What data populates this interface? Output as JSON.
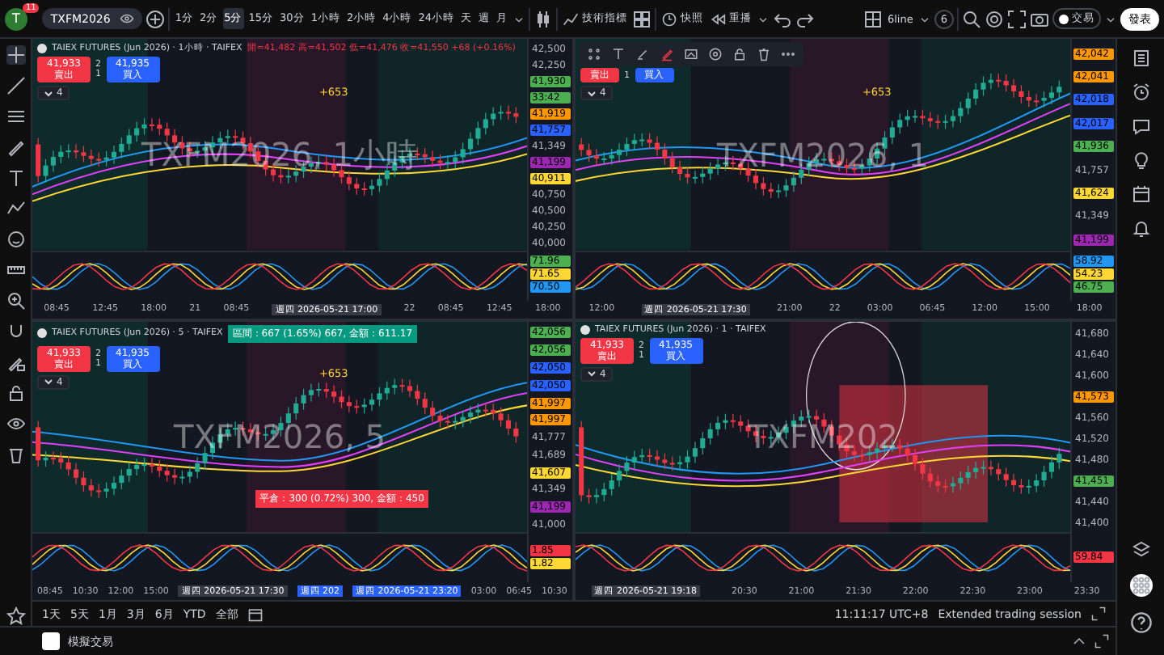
{
  "top_bar": {
    "avatar": "T",
    "badge": "11",
    "symbol": "TXFM2026",
    "intervals": [
      {
        "label": "1分",
        "selected": false
      },
      {
        "label": "2分",
        "selected": false
      },
      {
        "label": "5分",
        "selected": true
      },
      {
        "label": "15分",
        "selected": false
      },
      {
        "label": "30分",
        "selected": false
      },
      {
        "label": "1小時",
        "selected": false
      },
      {
        "label": "2小時",
        "selected": false
      },
      {
        "label": "4小時",
        "selected": false
      },
      {
        "label": "24小時",
        "selected": false
      },
      {
        "label": "天",
        "selected": false
      },
      {
        "label": "週",
        "selected": false
      },
      {
        "label": "月",
        "selected": false
      }
    ],
    "indicators": "技術指標",
    "snapshot": "快照",
    "replay": "重播",
    "layout_name": "6line",
    "layout_count": "6",
    "trade": "交易",
    "publish": "發表"
  },
  "panes": [
    {
      "title": "TAIEX FUTURES (Jun 2026) · 1小時 · TAIFEX",
      "ohlc": "開=41,482 高=41,502 低=41,476 收=41,550 +68 (+0.16%)",
      "sell_price": "41,933",
      "sell_label": "賣出",
      "spread": "2",
      "qty": "1",
      "buy_price": "41,935",
      "buy_label": "買入",
      "collapse": "4",
      "marker": "+653",
      "watermark": "TXFM2026, 1小時",
      "drawing_toolbar": false,
      "price_axis": [
        {
          "text": "42,500",
          "kind": "tick"
        },
        {
          "text": "42,250",
          "kind": "tick"
        },
        {
          "text": "41,930",
          "kind": "tag",
          "color": "#4caf50"
        },
        {
          "text": "33:42",
          "kind": "tag",
          "color": "#4caf50"
        },
        {
          "text": "41,919",
          "kind": "tag",
          "color": "#ff9800"
        },
        {
          "text": "41,757",
          "kind": "tag",
          "color": "#2962ff"
        },
        {
          "text": "41,349",
          "kind": "tick"
        },
        {
          "text": "41,199",
          "kind": "tag",
          "color": "#9c27b0"
        },
        {
          "text": "40,911",
          "kind": "tag",
          "color": "#fdd835"
        },
        {
          "text": "40,750",
          "kind": "tick"
        },
        {
          "text": "40,500",
          "kind": "tick"
        },
        {
          "text": "40,250",
          "kind": "tick"
        },
        {
          "text": "40,000",
          "kind": "tick"
        }
      ],
      "indicator_axis": [
        {
          "text": "71.96",
          "color": "#4caf50"
        },
        {
          "text": "71.65",
          "color": "#fdd835"
        },
        {
          "text": "70.50",
          "color": "#2196f3"
        }
      ],
      "time_axis": [
        {
          "text": "08:45",
          "kind": "tick"
        },
        {
          "text": "12:45",
          "kind": "tick"
        },
        {
          "text": "18:00",
          "kind": "tick"
        },
        {
          "text": "21",
          "kind": "tick"
        },
        {
          "text": "08:45",
          "kind": "tick"
        },
        {
          "text": "週四 2026-05-21  17:00",
          "kind": "tag"
        },
        {
          "text": "22",
          "kind": "tick"
        },
        {
          "text": "08:45",
          "kind": "tick"
        },
        {
          "text": "12:45",
          "kind": "tick"
        },
        {
          "text": "18:00",
          "kind": "tick"
        }
      ]
    },
    {
      "sell_label": "賣出",
      "qty": "1",
      "buy_label": "買入",
      "collapse": "4",
      "marker": "+653",
      "watermark": "TXFM2026, 1",
      "drawing_toolbar": true,
      "price_axis": [
        {
          "text": "42,042",
          "kind": "tag",
          "color": "#ff9800"
        },
        {
          "text": "42,041",
          "kind": "tag",
          "color": "#ff9800"
        },
        {
          "text": "42,018",
          "kind": "tag",
          "color": "#2962ff"
        },
        {
          "text": "42,017",
          "kind": "tag",
          "color": "#2962ff"
        },
        {
          "text": "41,936",
          "kind": "tag",
          "color": "#4caf50"
        },
        {
          "text": "41,757",
          "kind": "tick"
        },
        {
          "text": "41,624",
          "kind": "tag",
          "color": "#fdd835"
        },
        {
          "text": "41,349",
          "kind": "tick"
        },
        {
          "text": "41,199",
          "kind": "tag",
          "color": "#9c27b0"
        }
      ],
      "indicator_axis": [
        {
          "text": "58.92",
          "color": "#2196f3"
        },
        {
          "text": "54.23",
          "color": "#fdd835"
        },
        {
          "text": "46.75",
          "color": "#4caf50"
        }
      ],
      "time_axis": [
        {
          "text": "12:00",
          "kind": "tick"
        },
        {
          "text": "週四 2026-05-21  17:30",
          "kind": "tag"
        },
        {
          "text": "21:00",
          "kind": "tick"
        },
        {
          "text": "22",
          "kind": "tick"
        },
        {
          "text": "03:00",
          "kind": "tick"
        },
        {
          "text": "06:45",
          "kind": "tick"
        },
        {
          "text": "12:00",
          "kind": "tick"
        },
        {
          "text": "15:00",
          "kind": "tick"
        },
        {
          "text": "18:00",
          "kind": "tick"
        }
      ]
    },
    {
      "title": "TAIEX FUTURES (Jun 2026) · 5 · TAIFEX",
      "measure": "區間：667 (1.65%) 667, 金額：611.17",
      "note": "平倉：300 (0.72%) 300, 金額：450",
      "sell_price": "41,933",
      "sell_label": "賣出",
      "spread": "2",
      "qty": "1",
      "buy_price": "41,935",
      "buy_label": "買入",
      "collapse": "4",
      "marker": "+653",
      "watermark": "TXFM2026, 5",
      "drawing_toolbar": false,
      "price_axis": [
        {
          "text": "42,056",
          "kind": "tag",
          "color": "#4caf50"
        },
        {
          "text": "42,056",
          "kind": "tag",
          "color": "#4caf50"
        },
        {
          "text": "42,050",
          "kind": "tag",
          "color": "#2962ff"
        },
        {
          "text": "42,050",
          "kind": "tag",
          "color": "#2962ff"
        },
        {
          "text": "41,997",
          "kind": "tag",
          "color": "#ff9800"
        },
        {
          "text": "41,997",
          "kind": "tag",
          "color": "#ff9800"
        },
        {
          "text": "41,777",
          "kind": "tick"
        },
        {
          "text": "41,689",
          "kind": "tick"
        },
        {
          "text": "41,607",
          "kind": "tag",
          "color": "#fdd835"
        },
        {
          "text": "41,349",
          "kind": "tick"
        },
        {
          "text": "41,199",
          "kind": "tag",
          "color": "#9c27b0"
        },
        {
          "text": "41,000",
          "kind": "tick"
        }
      ],
      "indicator_axis": [
        {
          "text": "1.85",
          "color": "#f23645"
        },
        {
          "text": "1.82",
          "color": "#fdd835"
        }
      ],
      "time_axis": [
        {
          "text": "08:45",
          "kind": "tick"
        },
        {
          "text": "10:30",
          "kind": "tick"
        },
        {
          "text": "12:00",
          "kind": "tick"
        },
        {
          "text": "15:00",
          "kind": "tick"
        },
        {
          "text": "週四 2026-05-21  17:30",
          "kind": "tag"
        },
        {
          "text": "週四 202",
          "kind": "cursor"
        },
        {
          "text": "週四 2026-05-21  23:20",
          "kind": "cursor"
        },
        {
          "text": "03:00",
          "kind": "tick"
        },
        {
          "text": "06:45",
          "kind": "tick"
        },
        {
          "text": "10:30",
          "kind": "tick"
        }
      ]
    },
    {
      "title": "TAIEX FUTURES (Jun 2026) · 1 · TAIFEX",
      "sell_price": "41,933",
      "sell_label": "賣出",
      "spread": "2",
      "qty": "1",
      "buy_price": "41,935",
      "buy_label": "買入",
      "collapse": "4",
      "watermark": "TXFM202",
      "drawing_toolbar": false,
      "price_axis": [
        {
          "text": "41,680",
          "kind": "tick"
        },
        {
          "text": "41,640",
          "kind": "tick"
        },
        {
          "text": "41,600",
          "kind": "tick"
        },
        {
          "text": "41,573",
          "kind": "tag",
          "color": "#ff9800"
        },
        {
          "text": "41,560",
          "kind": "tick"
        },
        {
          "text": "41,520",
          "kind": "tick"
        },
        {
          "text": "41,480",
          "kind": "tick"
        },
        {
          "text": "41,451",
          "kind": "tag",
          "color": "#4caf50"
        },
        {
          "text": "41,440",
          "kind": "tick"
        },
        {
          "text": "41,400",
          "kind": "tick"
        }
      ],
      "indicator_axis": [
        {
          "text": "59.84",
          "color": "#f23645"
        }
      ],
      "time_axis": [
        {
          "text": "週四 2026-05-21  19:18",
          "kind": "tag"
        },
        {
          "text": "20:30",
          "kind": "tick"
        },
        {
          "text": "21:00",
          "kind": "tick"
        },
        {
          "text": "21:30",
          "kind": "tick"
        },
        {
          "text": "22:00",
          "kind": "tick"
        },
        {
          "text": "22:30",
          "kind": "tick"
        },
        {
          "text": "23:00",
          "kind": "tick"
        },
        {
          "text": "23:30",
          "kind": "tick"
        }
      ]
    }
  ],
  "range_bar": {
    "ranges": [
      "1天",
      "5天",
      "1月",
      "3月",
      "6月",
      "YTD",
      "全部"
    ],
    "clock": "11:11:17 UTC+8",
    "session": "Extended trading session"
  },
  "status_bar": {
    "label": "模擬交易"
  }
}
